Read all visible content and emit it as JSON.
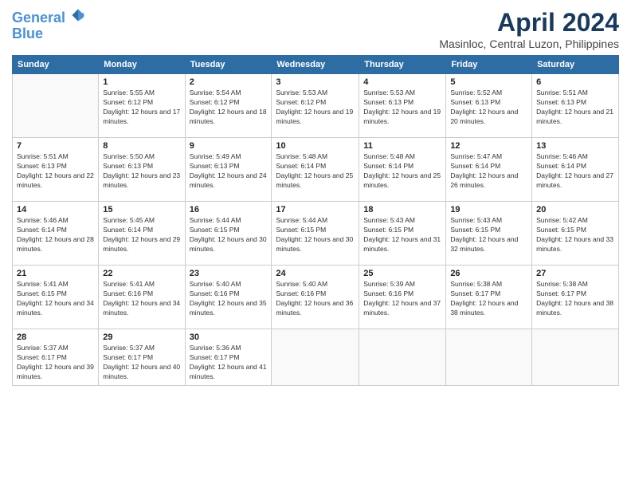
{
  "header": {
    "logo_line1": "General",
    "logo_line2": "Blue",
    "month": "April 2024",
    "location": "Masinloc, Central Luzon, Philippines"
  },
  "weekdays": [
    "Sunday",
    "Monday",
    "Tuesday",
    "Wednesday",
    "Thursday",
    "Friday",
    "Saturday"
  ],
  "weeks": [
    [
      {
        "day": "",
        "sunrise": "",
        "sunset": "",
        "daylight": ""
      },
      {
        "day": "1",
        "sunrise": "Sunrise: 5:55 AM",
        "sunset": "Sunset: 6:12 PM",
        "daylight": "Daylight: 12 hours and 17 minutes."
      },
      {
        "day": "2",
        "sunrise": "Sunrise: 5:54 AM",
        "sunset": "Sunset: 6:12 PM",
        "daylight": "Daylight: 12 hours and 18 minutes."
      },
      {
        "day": "3",
        "sunrise": "Sunrise: 5:53 AM",
        "sunset": "Sunset: 6:12 PM",
        "daylight": "Daylight: 12 hours and 19 minutes."
      },
      {
        "day": "4",
        "sunrise": "Sunrise: 5:53 AM",
        "sunset": "Sunset: 6:13 PM",
        "daylight": "Daylight: 12 hours and 19 minutes."
      },
      {
        "day": "5",
        "sunrise": "Sunrise: 5:52 AM",
        "sunset": "Sunset: 6:13 PM",
        "daylight": "Daylight: 12 hours and 20 minutes."
      },
      {
        "day": "6",
        "sunrise": "Sunrise: 5:51 AM",
        "sunset": "Sunset: 6:13 PM",
        "daylight": "Daylight: 12 hours and 21 minutes."
      }
    ],
    [
      {
        "day": "7",
        "sunrise": "Sunrise: 5:51 AM",
        "sunset": "Sunset: 6:13 PM",
        "daylight": "Daylight: 12 hours and 22 minutes."
      },
      {
        "day": "8",
        "sunrise": "Sunrise: 5:50 AM",
        "sunset": "Sunset: 6:13 PM",
        "daylight": "Daylight: 12 hours and 23 minutes."
      },
      {
        "day": "9",
        "sunrise": "Sunrise: 5:49 AM",
        "sunset": "Sunset: 6:13 PM",
        "daylight": "Daylight: 12 hours and 24 minutes."
      },
      {
        "day": "10",
        "sunrise": "Sunrise: 5:48 AM",
        "sunset": "Sunset: 6:14 PM",
        "daylight": "Daylight: 12 hours and 25 minutes."
      },
      {
        "day": "11",
        "sunrise": "Sunrise: 5:48 AM",
        "sunset": "Sunset: 6:14 PM",
        "daylight": "Daylight: 12 hours and 25 minutes."
      },
      {
        "day": "12",
        "sunrise": "Sunrise: 5:47 AM",
        "sunset": "Sunset: 6:14 PM",
        "daylight": "Daylight: 12 hours and 26 minutes."
      },
      {
        "day": "13",
        "sunrise": "Sunrise: 5:46 AM",
        "sunset": "Sunset: 6:14 PM",
        "daylight": "Daylight: 12 hours and 27 minutes."
      }
    ],
    [
      {
        "day": "14",
        "sunrise": "Sunrise: 5:46 AM",
        "sunset": "Sunset: 6:14 PM",
        "daylight": "Daylight: 12 hours and 28 minutes."
      },
      {
        "day": "15",
        "sunrise": "Sunrise: 5:45 AM",
        "sunset": "Sunset: 6:14 PM",
        "daylight": "Daylight: 12 hours and 29 minutes."
      },
      {
        "day": "16",
        "sunrise": "Sunrise: 5:44 AM",
        "sunset": "Sunset: 6:15 PM",
        "daylight": "Daylight: 12 hours and 30 minutes."
      },
      {
        "day": "17",
        "sunrise": "Sunrise: 5:44 AM",
        "sunset": "Sunset: 6:15 PM",
        "daylight": "Daylight: 12 hours and 30 minutes."
      },
      {
        "day": "18",
        "sunrise": "Sunrise: 5:43 AM",
        "sunset": "Sunset: 6:15 PM",
        "daylight": "Daylight: 12 hours and 31 minutes."
      },
      {
        "day": "19",
        "sunrise": "Sunrise: 5:43 AM",
        "sunset": "Sunset: 6:15 PM",
        "daylight": "Daylight: 12 hours and 32 minutes."
      },
      {
        "day": "20",
        "sunrise": "Sunrise: 5:42 AM",
        "sunset": "Sunset: 6:15 PM",
        "daylight": "Daylight: 12 hours and 33 minutes."
      }
    ],
    [
      {
        "day": "21",
        "sunrise": "Sunrise: 5:41 AM",
        "sunset": "Sunset: 6:15 PM",
        "daylight": "Daylight: 12 hours and 34 minutes."
      },
      {
        "day": "22",
        "sunrise": "Sunrise: 5:41 AM",
        "sunset": "Sunset: 6:16 PM",
        "daylight": "Daylight: 12 hours and 34 minutes."
      },
      {
        "day": "23",
        "sunrise": "Sunrise: 5:40 AM",
        "sunset": "Sunset: 6:16 PM",
        "daylight": "Daylight: 12 hours and 35 minutes."
      },
      {
        "day": "24",
        "sunrise": "Sunrise: 5:40 AM",
        "sunset": "Sunset: 6:16 PM",
        "daylight": "Daylight: 12 hours and 36 minutes."
      },
      {
        "day": "25",
        "sunrise": "Sunrise: 5:39 AM",
        "sunset": "Sunset: 6:16 PM",
        "daylight": "Daylight: 12 hours and 37 minutes."
      },
      {
        "day": "26",
        "sunrise": "Sunrise: 5:38 AM",
        "sunset": "Sunset: 6:17 PM",
        "daylight": "Daylight: 12 hours and 38 minutes."
      },
      {
        "day": "27",
        "sunrise": "Sunrise: 5:38 AM",
        "sunset": "Sunset: 6:17 PM",
        "daylight": "Daylight: 12 hours and 38 minutes."
      }
    ],
    [
      {
        "day": "28",
        "sunrise": "Sunrise: 5:37 AM",
        "sunset": "Sunset: 6:17 PM",
        "daylight": "Daylight: 12 hours and 39 minutes."
      },
      {
        "day": "29",
        "sunrise": "Sunrise: 5:37 AM",
        "sunset": "Sunset: 6:17 PM",
        "daylight": "Daylight: 12 hours and 40 minutes."
      },
      {
        "day": "30",
        "sunrise": "Sunrise: 5:36 AM",
        "sunset": "Sunset: 6:17 PM",
        "daylight": "Daylight: 12 hours and 41 minutes."
      },
      {
        "day": "",
        "sunrise": "",
        "sunset": "",
        "daylight": ""
      },
      {
        "day": "",
        "sunrise": "",
        "sunset": "",
        "daylight": ""
      },
      {
        "day": "",
        "sunrise": "",
        "sunset": "",
        "daylight": ""
      },
      {
        "day": "",
        "sunrise": "",
        "sunset": "",
        "daylight": ""
      }
    ]
  ]
}
